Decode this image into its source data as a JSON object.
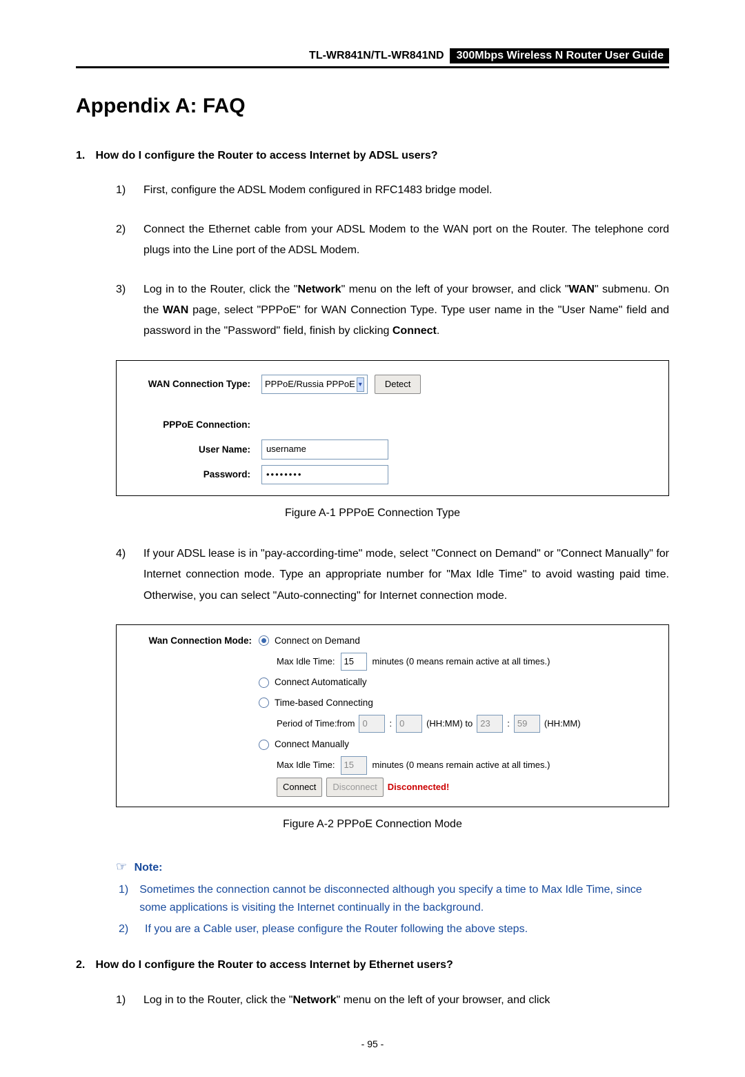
{
  "header": {
    "model": "TL-WR841N/TL-WR841ND",
    "guide": "300Mbps Wireless N Router User Guide"
  },
  "title": "Appendix A: FAQ",
  "q1": {
    "num": "1.",
    "question": "How do I configure the Router to access Internet by ADSL users?",
    "s1_idx": "1)",
    "s1_txt": "First, configure the ADSL Modem configured in RFC1483 bridge model.",
    "s2_idx": "2)",
    "s2_txt": "Connect the Ethernet cable from your ADSL Modem to the WAN port on the Router. The telephone cord plugs into the Line port of the ADSL Modem.",
    "s3_idx": "3)",
    "s3_pre": "Log in to the Router, click the \"",
    "s3_b1": "Network",
    "s3_mid1": "\" menu on the left of your browser, and click \"",
    "s3_b2": "WAN",
    "s3_mid2": "\" submenu. On the ",
    "s3_b3": "WAN",
    "s3_mid3": " page, select \"PPPoE\" for WAN Connection Type. Type user name in the \"User Name\" field and password in the \"Password\" field, finish by clicking ",
    "s3_b4": "Connect",
    "s3_post": ".",
    "s4_idx": "4)",
    "s4_txt": "If your ADSL lease is in \"pay-according-time\" mode, select \"Connect on Demand\" or \"Connect Manually\" for Internet connection mode. Type an appropriate number for \"Max Idle Time\" to avoid wasting paid time. Otherwise, you can select \"Auto-connecting\" for Internet connection mode."
  },
  "figA1": {
    "wan_conn_type_lbl": "WAN Connection Type:",
    "wan_conn_type_val": "PPPoE/Russia PPPoE",
    "detect_btn": "Detect",
    "pppoe_lbl": "PPPoE Connection:",
    "user_lbl": "User Name:",
    "user_val": "username",
    "pwd_lbl": "Password:",
    "pwd_val": "••••••••",
    "caption": "Figure A-1    PPPoE Connection Type"
  },
  "figA2": {
    "mode_lbl": "Wan Connection Mode:",
    "opt_demand": "Connect on Demand",
    "max_idle": "Max Idle Time:",
    "idle_val1": "15",
    "idle_suffix": "minutes (0 means remain active at all times.)",
    "opt_auto": "Connect Automatically",
    "opt_time": "Time-based Connecting",
    "period_from": "Period of Time:from",
    "t_from_h": "0",
    "t_from_m": "0",
    "hhmm_to": "(HH:MM) to",
    "t_to_h": "23",
    "t_to_m": "59",
    "hhmm": "(HH:MM)",
    "opt_manual": "Connect Manually",
    "idle_val2": "15",
    "btn_connect": "Connect",
    "btn_disconnect": "Disconnect",
    "status": "Disconnected!",
    "caption": "Figure A-2    PPPoE Connection Mode"
  },
  "note": {
    "head": "Note:",
    "n1_idx": "1)",
    "n1_txt": "Sometimes the connection cannot be disconnected although you specify a time to Max Idle Time, since some applications is visiting the Internet continually in the background.",
    "n2_idx": "2)",
    "n2_txt": "If you are a Cable user, please configure the Router following the above steps."
  },
  "q2": {
    "num": "2.",
    "question": "How do I configure the Router to access Internet by Ethernet users?",
    "s1_idx": "1)",
    "s1_pre": "Log in to the Router, click the \"",
    "s1_b1": "Network",
    "s1_post": "\" menu on the left of your browser, and click"
  },
  "page_number": "- 95 -"
}
